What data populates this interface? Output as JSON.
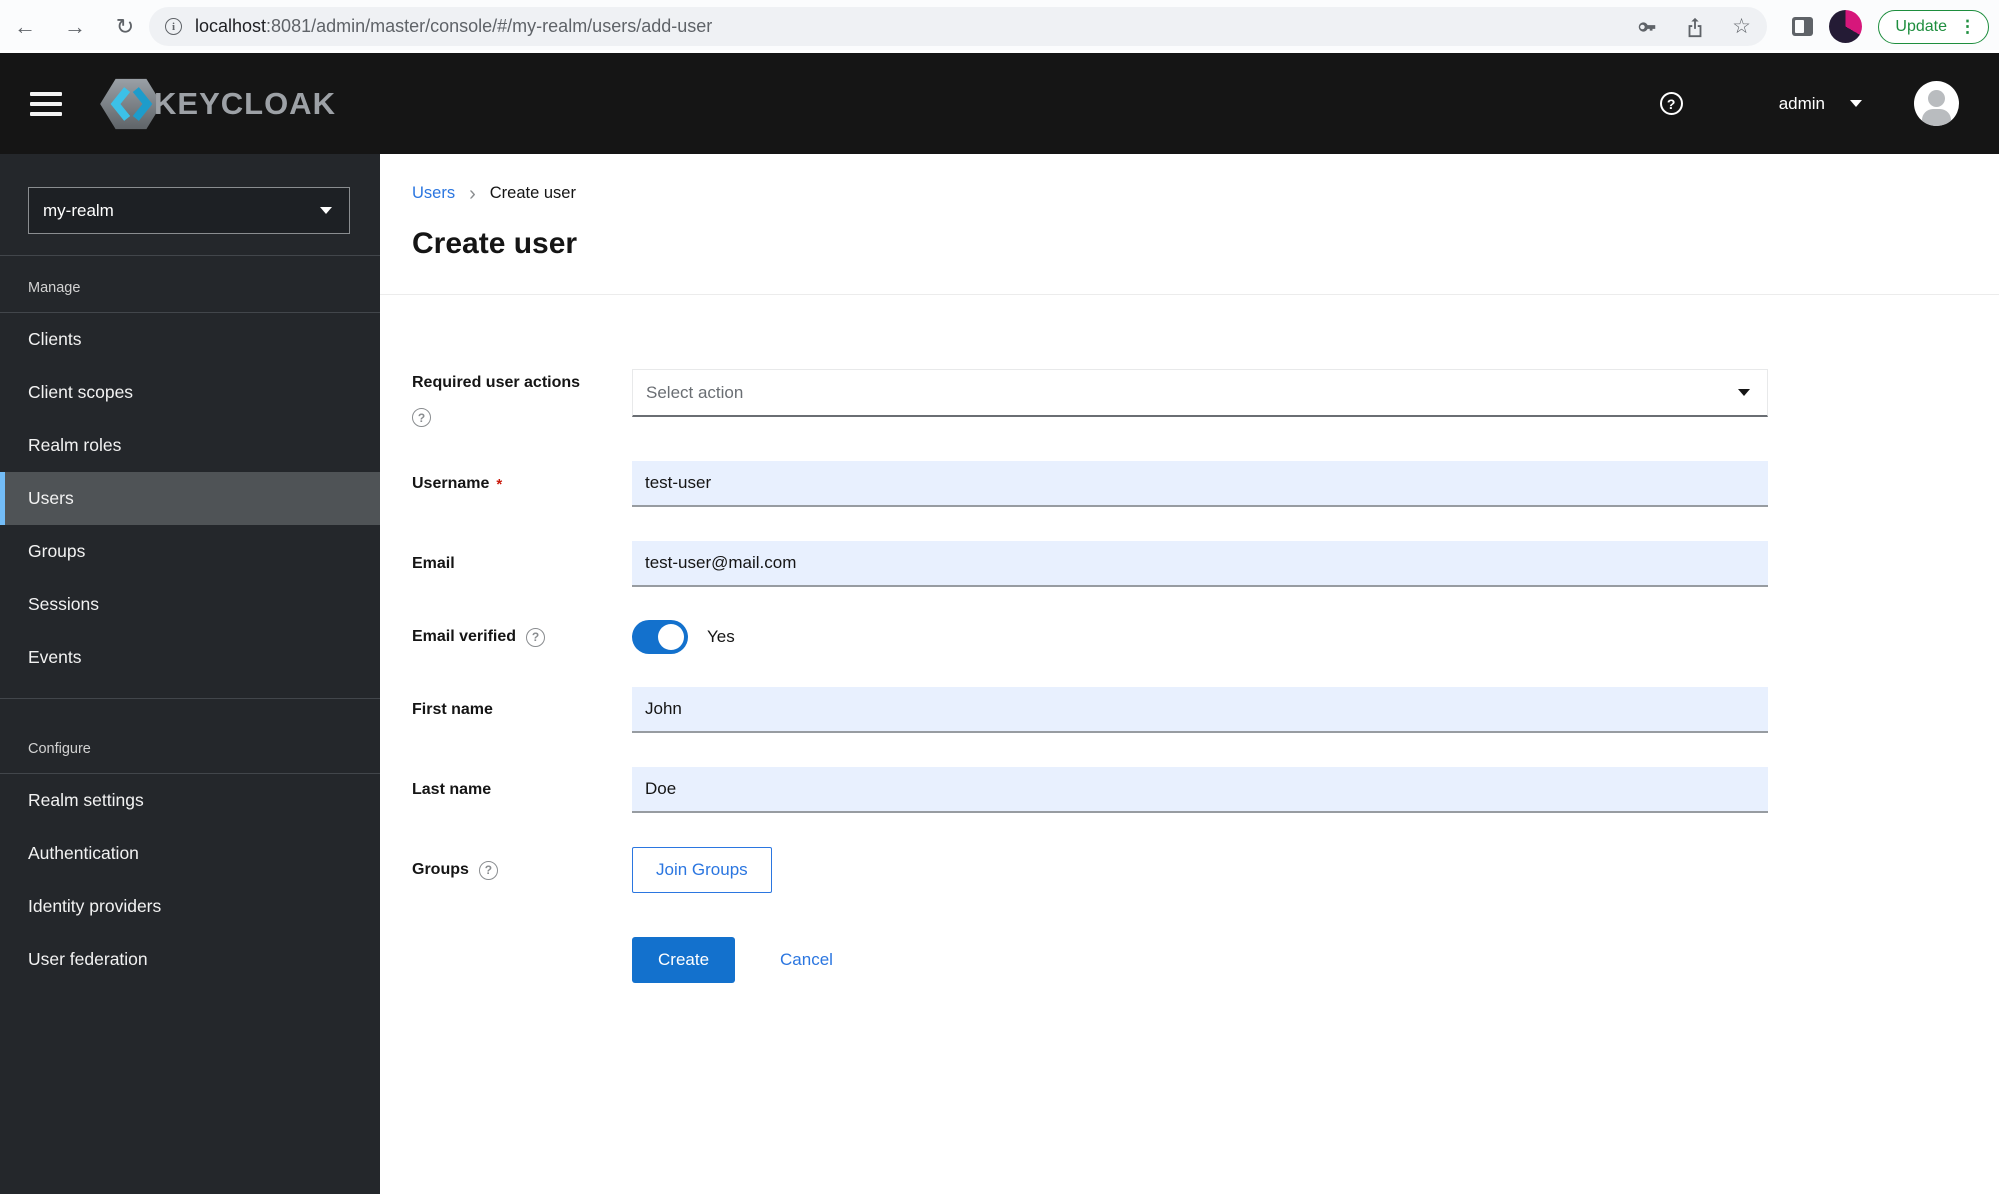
{
  "browser": {
    "url_host": "localhost",
    "url_rest": ":8081/admin/master/console/#/my-realm/users/add-user",
    "update_label": "Update"
  },
  "icons": {
    "back": "←",
    "forward": "→",
    "reload": "↻",
    "info": "i",
    "key": "⚿",
    "share": "⇪",
    "star": "☆",
    "more_vertical": "⋮",
    "help": "?",
    "breadcrumb_chevron": "›",
    "asterisk": "*"
  },
  "masthead": {
    "brand": "KEYCLOAK",
    "username": "admin"
  },
  "sidebar": {
    "realm": "my-realm",
    "sections": [
      {
        "label": "Manage",
        "items": [
          {
            "label": "Clients"
          },
          {
            "label": "Client scopes"
          },
          {
            "label": "Realm roles"
          },
          {
            "label": "Users"
          },
          {
            "label": "Groups"
          },
          {
            "label": "Sessions"
          },
          {
            "label": "Events"
          }
        ]
      },
      {
        "label": "Configure",
        "items": [
          {
            "label": "Realm settings"
          },
          {
            "label": "Authentication"
          },
          {
            "label": "Identity providers"
          },
          {
            "label": "User federation"
          }
        ]
      }
    ]
  },
  "breadcrumb": {
    "parent": "Users",
    "current": "Create user"
  },
  "page": {
    "title": "Create user"
  },
  "form": {
    "required_user_actions": {
      "label": "Required user actions",
      "placeholder": "Select action"
    },
    "username": {
      "label": "Username",
      "value": "test-user"
    },
    "email": {
      "label": "Email",
      "value": "test-user@mail.com"
    },
    "email_verified": {
      "label": "Email verified",
      "state": "Yes"
    },
    "first_name": {
      "label": "First name",
      "value": "John"
    },
    "last_name": {
      "label": "Last name",
      "value": "Doe"
    },
    "groups": {
      "label": "Groups",
      "button": "Join Groups"
    },
    "create_label": "Create",
    "cancel_label": "Cancel"
  },
  "colors": {
    "primary_blue": "#1371cd",
    "link_blue": "#2b76e0",
    "nav_selected_bg": "#4f5356",
    "nav_accent": "#73bcf7",
    "input_autofill_bg": "#e8f0fe",
    "masthead_bg": "#151515",
    "sidebar_bg": "#24272b",
    "update_green": "#1e8e3e",
    "required_red": "#c9190b"
  }
}
